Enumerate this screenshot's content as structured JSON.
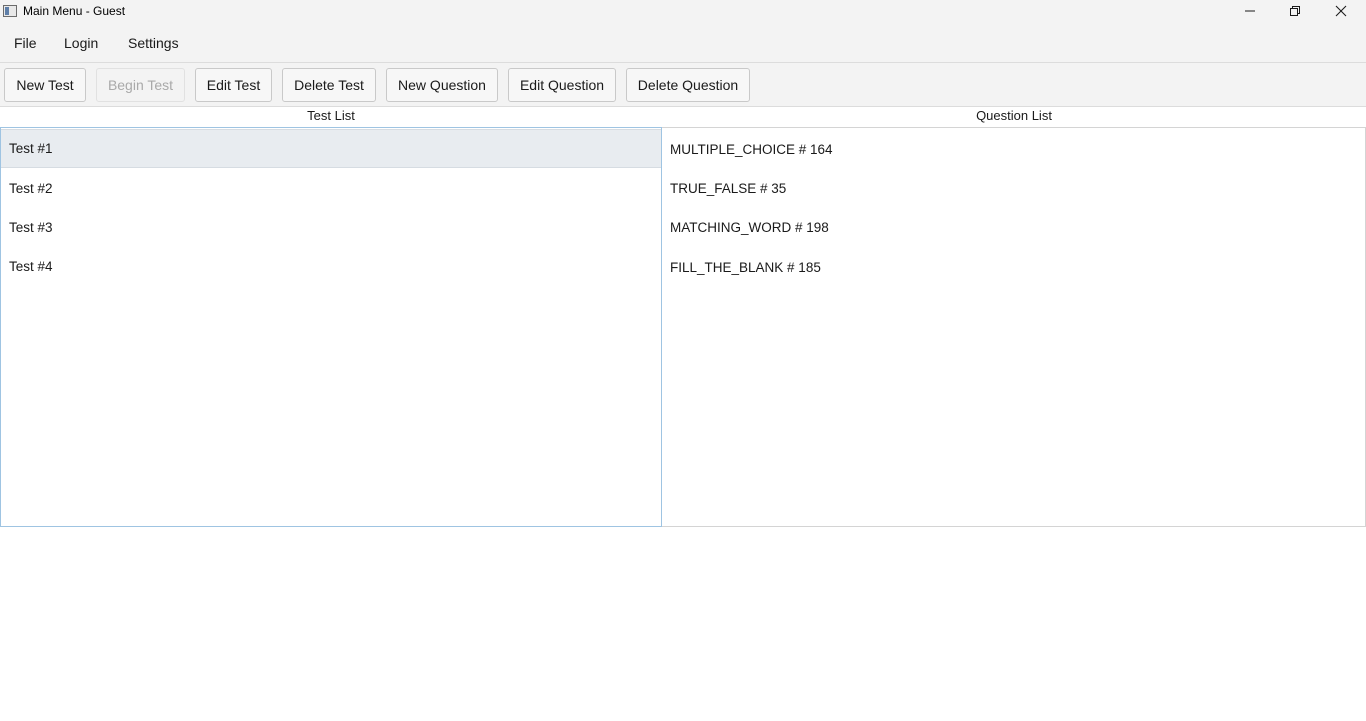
{
  "window": {
    "title": "Main Menu - Guest",
    "controls": [
      "minimize-icon",
      "restore-icon",
      "close-icon"
    ]
  },
  "menu": {
    "file": "File",
    "login": "Login",
    "settings": "Settings"
  },
  "toolbar": {
    "new_test": "New Test",
    "begin_test": "Begin Test",
    "edit_test": "Edit Test",
    "delete_test": "Delete Test",
    "new_question": "New Question",
    "edit_question": "Edit Question",
    "delete_question": "Delete Question"
  },
  "test_list": {
    "header": "Test List",
    "items": [
      "Test #1",
      "Test #2",
      "Test #3",
      "Test #4"
    ],
    "selected_index": 0
  },
  "question_list": {
    "header": "Question List",
    "items": [
      "MULTIPLE_CHOICE # 164",
      "TRUE_FALSE # 35",
      "MATCHING_WORD # 198",
      "FILL_THE_BLANK # 185"
    ]
  },
  "colors": {
    "chrome_bg": "#f3f3f3",
    "selection_bg": "#e8ecf0",
    "focus_border": "#9fc4e2",
    "disabled_text": "#a9a9a9"
  }
}
